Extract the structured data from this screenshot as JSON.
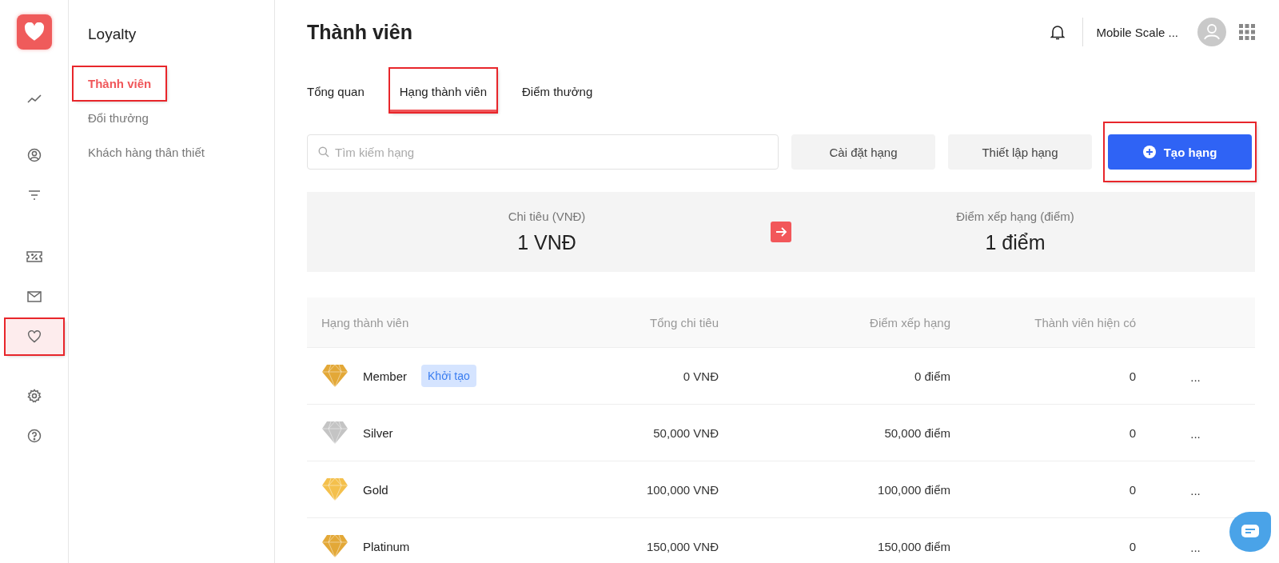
{
  "rail": {
    "items": [
      {
        "selected": false,
        "annotated": false
      },
      {
        "selected": false,
        "annotated": false
      },
      {
        "selected": false,
        "annotated": false
      },
      {
        "selected": false,
        "annotated": false
      },
      {
        "selected": false,
        "annotated": false
      },
      {
        "selected": true,
        "annotated": true
      },
      {
        "selected": false,
        "annotated": false
      },
      {
        "selected": false,
        "annotated": false
      }
    ]
  },
  "sidebar": {
    "title": "Loyalty",
    "items": [
      {
        "label": "Thành viên",
        "selected": true,
        "annotated": true
      },
      {
        "label": "Đổi thưởng",
        "selected": false,
        "annotated": false
      },
      {
        "label": "Khách hàng thân thiết",
        "selected": false,
        "annotated": false
      }
    ]
  },
  "header": {
    "title": "Thành viên",
    "account": "Mobile Scale ..."
  },
  "tabs": [
    {
      "label": "Tổng quan",
      "selected": false,
      "annotated": false
    },
    {
      "label": "Hạng thành viên",
      "selected": true,
      "annotated": true
    },
    {
      "label": "Điểm thưởng",
      "selected": false,
      "annotated": false
    }
  ],
  "search": {
    "placeholder": "Tìm kiếm hạng"
  },
  "buttons": [
    {
      "label": "Cài đặt hạng",
      "kind": "secondary",
      "annotated": false
    },
    {
      "label": "Thiết lập hạng",
      "kind": "secondary",
      "annotated": false
    },
    {
      "label": "Tạo hạng",
      "kind": "primary",
      "annotated": true
    }
  ],
  "conversion": {
    "from_label": "Chi tiêu (VNĐ)",
    "from_value": "1 VNĐ",
    "to_label": "Điểm xếp hạng (điểm)",
    "to_value": "1 điểm"
  },
  "table": {
    "columns": [
      "Hạng thành viên",
      "Tổng chi tiêu",
      "Điểm xếp hạng",
      "Thành viên hiện có"
    ],
    "rows": [
      {
        "name": "Member",
        "badge": "Khởi tạo",
        "color": "#e3a837",
        "spend": "0 VNĐ",
        "points": "0 điểm",
        "members": "0",
        "menu": "..."
      },
      {
        "name": "Silver",
        "color": "#c4c4c4",
        "spend": "50,000 VNĐ",
        "points": "50,000 điểm",
        "members": "0",
        "menu": "..."
      },
      {
        "name": "Gold",
        "color": "#f4c04c",
        "spend": "100,000 VNĐ",
        "points": "100,000 điểm",
        "members": "0",
        "menu": "..."
      },
      {
        "name": "Platinum",
        "color": "#e3a837",
        "spend": "150,000 VNĐ",
        "points": "150,000 điểm",
        "members": "0",
        "menu": "..."
      }
    ]
  }
}
